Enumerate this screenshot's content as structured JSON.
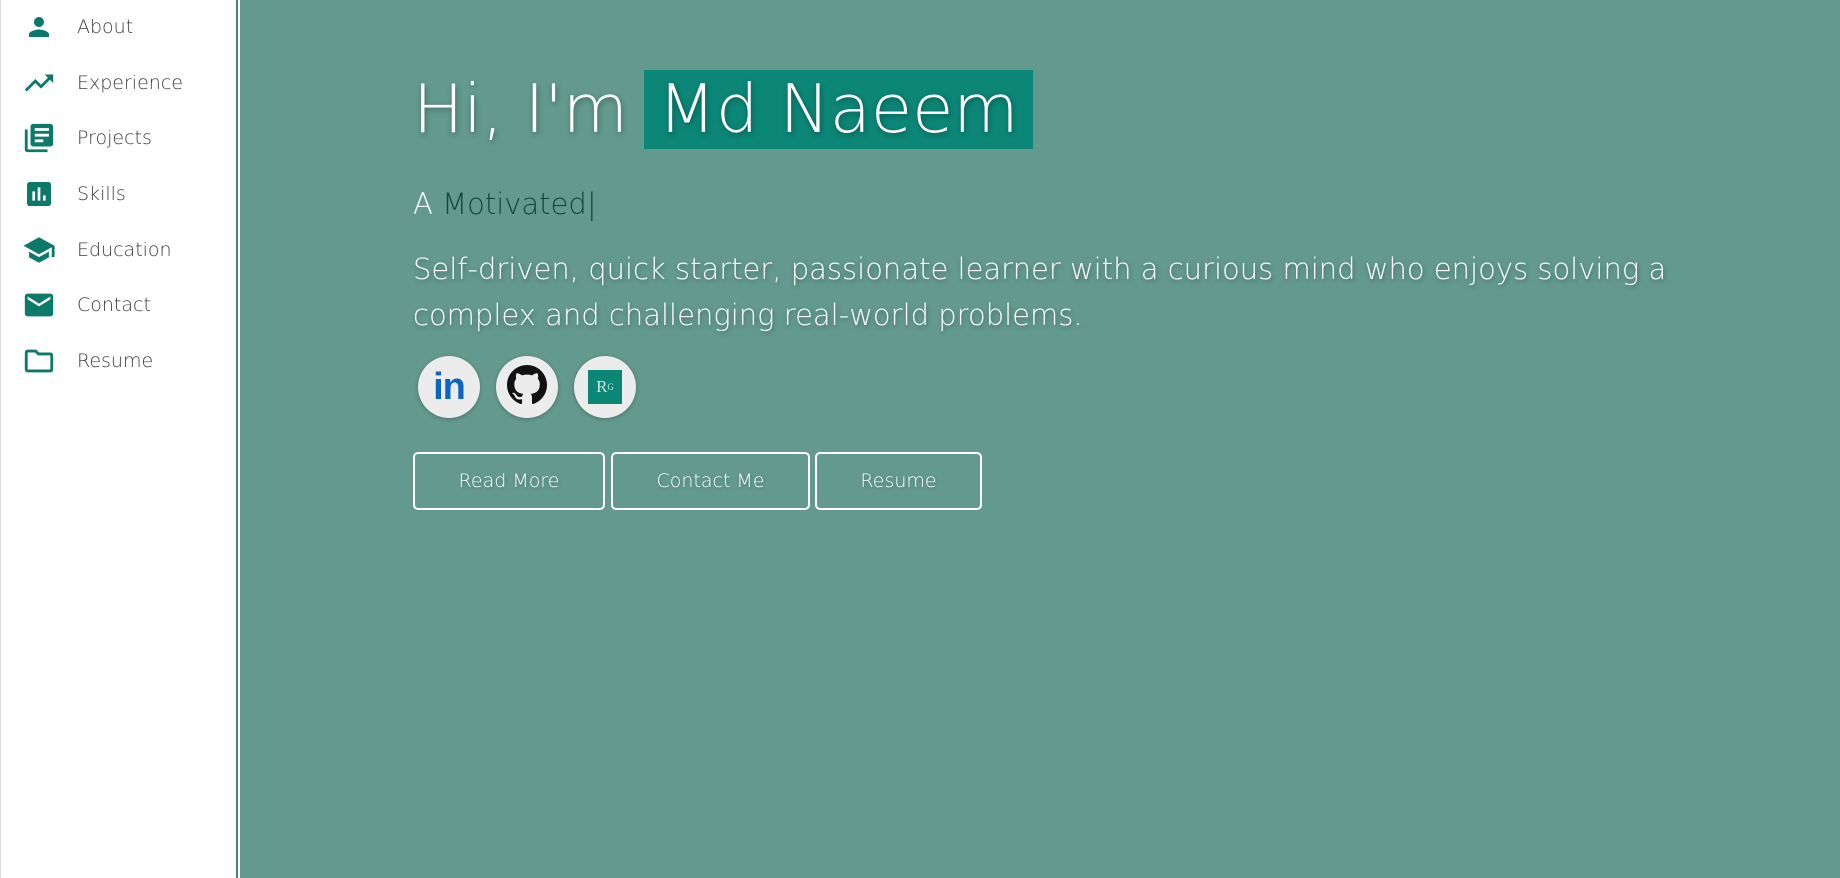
{
  "sidebar": {
    "items": [
      {
        "label": "About",
        "icon": "person-icon"
      },
      {
        "label": "Experience",
        "icon": "trending-up-icon"
      },
      {
        "label": "Projects",
        "icon": "library-books-icon"
      },
      {
        "label": "Skills",
        "icon": "bar-chart-icon"
      },
      {
        "label": "Education",
        "icon": "graduation-cap-icon"
      },
      {
        "label": "Contact",
        "icon": "mail-icon"
      },
      {
        "label": "Resume",
        "icon": "folder-icon"
      }
    ]
  },
  "hero": {
    "greeting": "Hi, I'm",
    "name": "Md Naeem",
    "tagline_prefix": "A",
    "tagline_word": "Motivated",
    "tagline_cursor": "|",
    "bio": "Self-driven, quick starter, passionate learner with a curious mind who enjoys solving a complex and challenging real-world problems."
  },
  "social": {
    "linkedin_text": "in",
    "researchgate_text": "R",
    "researchgate_sup": "G"
  },
  "buttons": {
    "read_more": "Read More",
    "contact_me": "Contact Me",
    "resume": "Resume"
  },
  "colors": {
    "main_bg": "#639a8d",
    "accent": "#0b8677",
    "icon": "#0b7a6b",
    "sidebar_bg": "#ffffff"
  }
}
